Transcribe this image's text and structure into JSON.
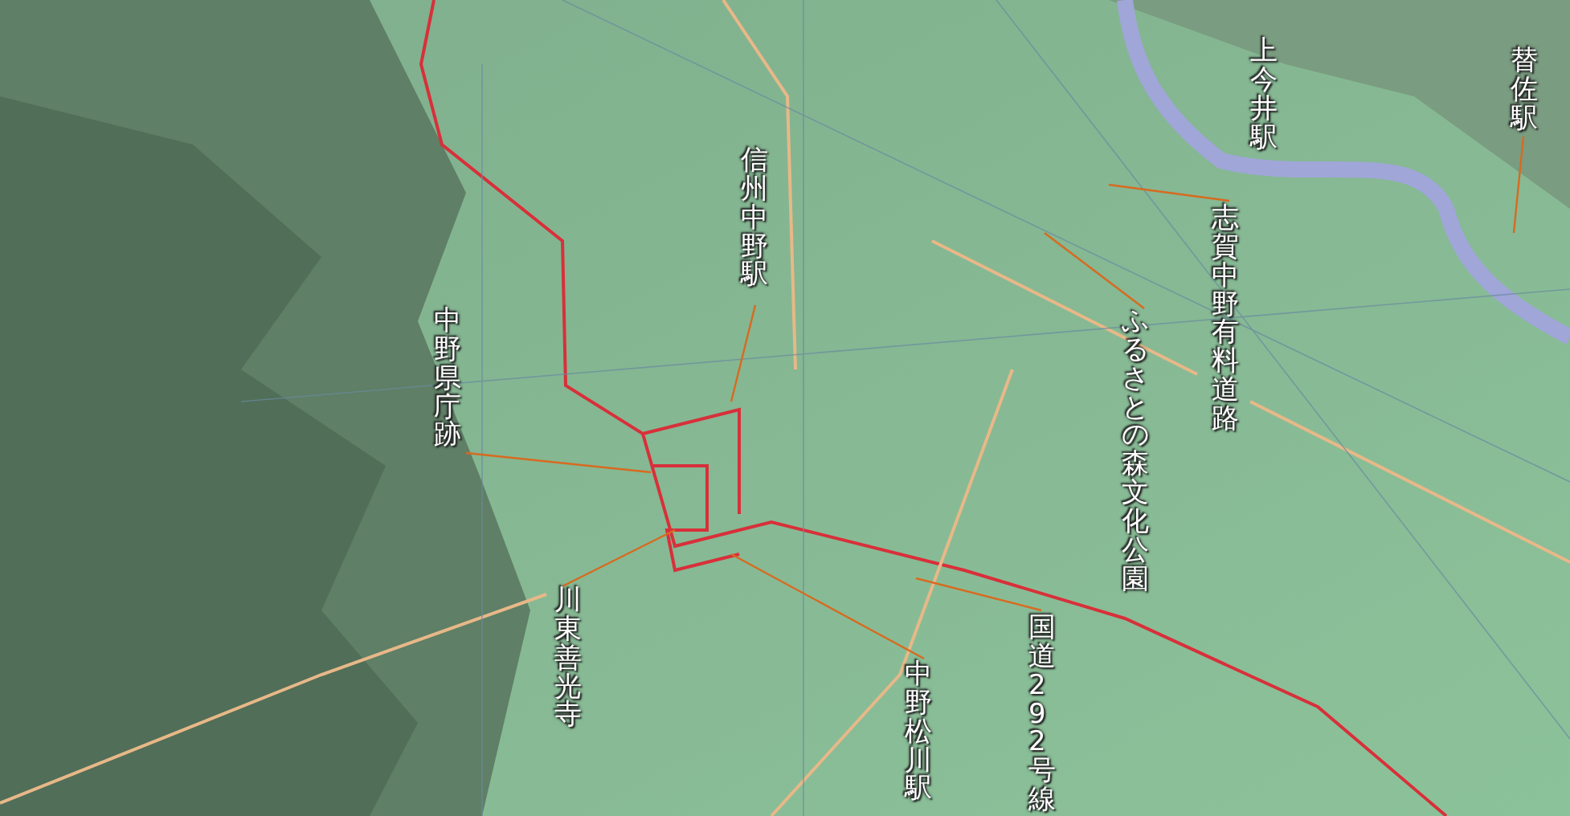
{
  "map": {
    "labels": [
      {
        "text": "上今井駅"
      },
      {
        "text": "替佐駅"
      },
      {
        "text": "信州中野駅"
      },
      {
        "text": "志賀中野有料道路"
      },
      {
        "text": "中野県庁跡"
      },
      {
        "text": "ふるさとの森文化公園"
      },
      {
        "text": "川東善光寺"
      },
      {
        "text": "中野松川駅"
      },
      {
        "text": "国道292号線"
      }
    ]
  }
}
